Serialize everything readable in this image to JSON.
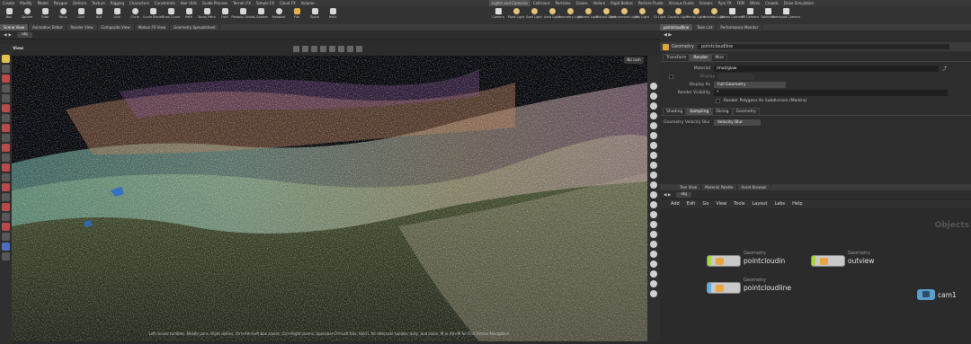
{
  "shelf": {
    "tabs_left": [
      "Create",
      "Modify",
      "Model",
      "Polygon",
      "Deform",
      "Texture",
      "Rigging",
      "Characters",
      "Constraints",
      "Hair Utils",
      "Guide Process",
      "Terrain FX",
      "Simple FX",
      "Cloud FX",
      "Volume"
    ],
    "tabs_right": [
      "Lights and Cameras",
      "Collisions",
      "Particles",
      "Grains",
      "Vellum",
      "Rigid Bodies",
      "Particle Fluids",
      "Viscous Fluids",
      "Oceans",
      "Pyro FX",
      "FEM",
      "Wires",
      "Crowds",
      "Drive Simulation"
    ],
    "tools_left": [
      "Box",
      "Sphere",
      "Tube",
      "Torus",
      "Grid",
      "Null",
      "Line",
      "Circle",
      "Curve Bezier",
      "Draw Curve",
      "Path",
      "Spray Paint",
      "Font",
      "Platonic Solids",
      "L-System",
      "Metaball",
      "File",
      "Spiral",
      "Helix"
    ],
    "tools_right": [
      "Camera",
      "Point Light",
      "Spot Light",
      "Area Light",
      "Geometry Light",
      "Volume Light",
      "Distant Light",
      "Environment Light",
      "Sky Light",
      "GI Light",
      "Caustic Light",
      "Portal Light",
      "Ambient Light",
      "Stereo Camera",
      "VR Camera",
      "Switcher",
      "Gamepad Camera"
    ]
  },
  "left_pane": {
    "tabs": [
      "Scene View",
      "Animation Editor",
      "Render View",
      "Composite View",
      "Motion FX View",
      "Geometry Spreadsheet"
    ],
    "path": "obj",
    "view_label": "View",
    "camera_badge": "No cam",
    "status_text": "Left mouse tumbles. Middle pans. Right dollies. Ctrl+Alt+Left box zooms. Ctrl+Right zooms. Spacebar-Ctrl-Left tilts. Hold L for alternate tumble, dolly, and zoom.    M or Alt+M for First Person Navigation."
  },
  "param_pane": {
    "tabs": [
      "pointcloudline",
      "Take List",
      "Performance Monitor"
    ],
    "node_type": "Geometry",
    "node_name": "pointcloudline",
    "main_tabs": [
      "Transform",
      "Render",
      "Misc"
    ],
    "material_label": "Material",
    "material_value": "/mat/glow",
    "display_label": "Display",
    "display_as_label": "Display As",
    "display_as_value": "Full Geometry",
    "render_visibility_label": "Render Visibility",
    "render_visibility_value": "*",
    "subdivision_label": "Render Polygons As Subdivision (Mantra)",
    "sub_tabs": [
      "Shading",
      "Sampling",
      "Dicing",
      "Geometry"
    ],
    "velocity_label": "Geometry Velocity Blur",
    "velocity_value": "Velocity Blur"
  },
  "network_pane": {
    "tabs": [
      "Tree View",
      "Material Palette",
      "Asset Browser"
    ],
    "path": "obj",
    "menu": [
      "Add",
      "Edit",
      "Go",
      "View",
      "Tools",
      "Layout",
      "Labs",
      "Help"
    ],
    "context_label": "Objects",
    "nodes": [
      {
        "type": "Geometry",
        "name": "pointcloudin"
      },
      {
        "type": "Geometry",
        "name": "outview"
      },
      {
        "type": "Geometry",
        "name": "pointcloudline"
      },
      {
        "type": "",
        "name": "cam1"
      }
    ]
  }
}
